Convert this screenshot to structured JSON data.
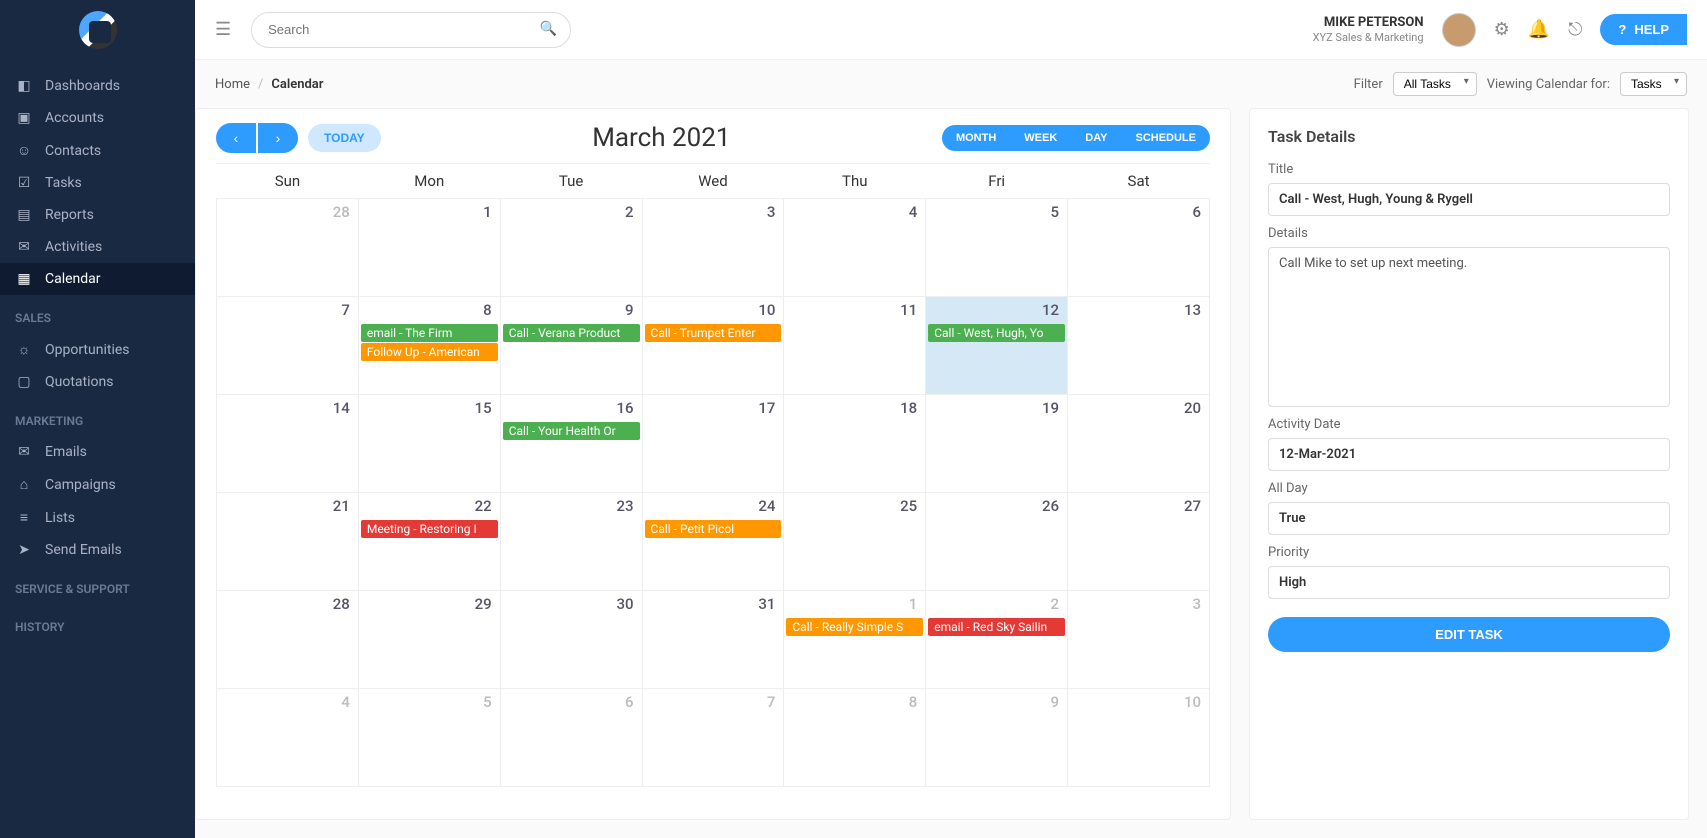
{
  "sidebar": {
    "items": [
      {
        "icon": "◧",
        "label": "Dashboards"
      },
      {
        "icon": "▣",
        "label": "Accounts"
      },
      {
        "icon": "☺",
        "label": "Contacts"
      },
      {
        "icon": "☑",
        "label": "Tasks"
      },
      {
        "icon": "▤",
        "label": "Reports"
      },
      {
        "icon": "✉",
        "label": "Activities"
      },
      {
        "icon": "▦",
        "label": "Calendar",
        "active": true
      }
    ],
    "sales_label": "SALES",
    "sales": [
      {
        "icon": "☼",
        "label": "Opportunities"
      },
      {
        "icon": "▢",
        "label": "Quotations"
      }
    ],
    "marketing_label": "MARKETING",
    "marketing": [
      {
        "icon": "✉",
        "label": "Emails"
      },
      {
        "icon": "⌂",
        "label": "Campaigns"
      },
      {
        "icon": "≡",
        "label": "Lists"
      },
      {
        "icon": "➤",
        "label": "Send Emails"
      }
    ],
    "service_label": "SERVICE & SUPPORT",
    "history_label": "HISTORY"
  },
  "topbar": {
    "search_placeholder": "Search",
    "user_name": "MIKE PETERSON",
    "user_sub": "XYZ Sales & Marketing",
    "help_label": "HELP"
  },
  "breadcrumb": {
    "home": "Home",
    "current": "Calendar",
    "filter_label": "Filter",
    "filter_value": "All Tasks",
    "viewing_label": "Viewing Calendar for:",
    "viewing_value": "Tasks"
  },
  "calendar": {
    "today_label": "TODAY",
    "title": "March 2021",
    "views": [
      "MONTH",
      "WEEK",
      "DAY",
      "SCHEDULE"
    ],
    "dow": [
      "Sun",
      "Mon",
      "Tue",
      "Wed",
      "Thu",
      "Fri",
      "Sat"
    ],
    "weeks": [
      [
        {
          "n": "28",
          "muted": true
        },
        {
          "n": "1"
        },
        {
          "n": "2"
        },
        {
          "n": "3"
        },
        {
          "n": "4"
        },
        {
          "n": "5"
        },
        {
          "n": "6"
        }
      ],
      [
        {
          "n": "7"
        },
        {
          "n": "8",
          "events": [
            {
              "t": "email - The Firm",
              "c": "green"
            },
            {
              "t": "Follow Up - American",
              "c": "orange"
            }
          ]
        },
        {
          "n": "9",
          "events": [
            {
              "t": "Call - Verana Product",
              "c": "green"
            }
          ]
        },
        {
          "n": "10",
          "events": [
            {
              "t": "Call - Trumpet Enter",
              "c": "orange"
            }
          ]
        },
        {
          "n": "11"
        },
        {
          "n": "12",
          "selected": true,
          "events": [
            {
              "t": "Call - West, Hugh, Yo",
              "c": "green"
            }
          ]
        },
        {
          "n": "13"
        }
      ],
      [
        {
          "n": "14"
        },
        {
          "n": "15"
        },
        {
          "n": "16",
          "events": [
            {
              "t": "Call - Your Health Or",
              "c": "green"
            }
          ]
        },
        {
          "n": "17"
        },
        {
          "n": "18"
        },
        {
          "n": "19"
        },
        {
          "n": "20"
        }
      ],
      [
        {
          "n": "21"
        },
        {
          "n": "22",
          "events": [
            {
              "t": "Meeting - Restoring I",
              "c": "red"
            }
          ]
        },
        {
          "n": "23"
        },
        {
          "n": "24",
          "events": [
            {
              "t": "Call - Petit Picol",
              "c": "orange"
            }
          ]
        },
        {
          "n": "25"
        },
        {
          "n": "26"
        },
        {
          "n": "27"
        }
      ],
      [
        {
          "n": "28"
        },
        {
          "n": "29"
        },
        {
          "n": "30"
        },
        {
          "n": "31"
        },
        {
          "n": "1",
          "muted": true,
          "events": [
            {
              "t": "Call - Really Simple S",
              "c": "orange"
            }
          ]
        },
        {
          "n": "2",
          "muted": true,
          "events": [
            {
              "t": "email - Red Sky Sailin",
              "c": "red"
            }
          ]
        },
        {
          "n": "3",
          "muted": true
        }
      ],
      [
        {
          "n": "4",
          "muted": true
        },
        {
          "n": "5",
          "muted": true
        },
        {
          "n": "6",
          "muted": true
        },
        {
          "n": "7",
          "muted": true
        },
        {
          "n": "8",
          "muted": true
        },
        {
          "n": "9",
          "muted": true
        },
        {
          "n": "10",
          "muted": true
        }
      ]
    ]
  },
  "details": {
    "panel_title": "Task Details",
    "title_label": "Title",
    "title_value": "Call - West, Hugh, Young & Rygell",
    "details_label": "Details",
    "details_value": "Call Mike to set up next meeting.",
    "date_label": "Activity Date",
    "date_value": "12-Mar-2021",
    "allday_label": "All Day",
    "allday_value": "True",
    "priority_label": "Priority",
    "priority_value": "High",
    "edit_label": "EDIT TASK"
  }
}
